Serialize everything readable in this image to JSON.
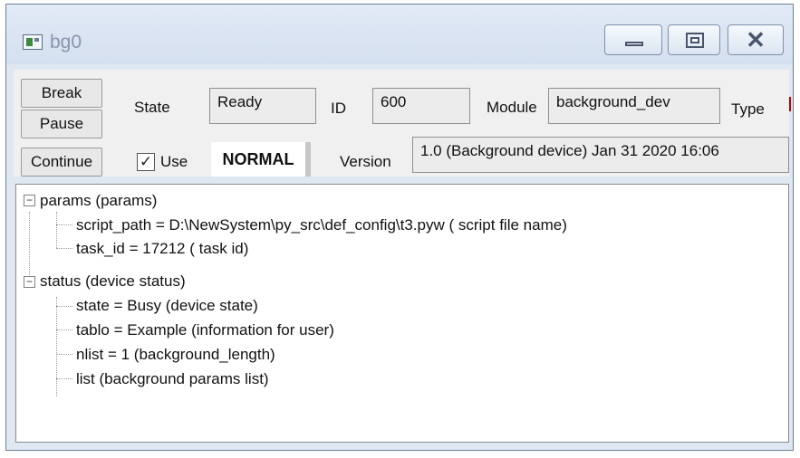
{
  "window": {
    "title": "bg0",
    "close_glyph": "✕"
  },
  "controls": {
    "break_label": "Break",
    "pause_label": "Pause",
    "continue_label": "Continue",
    "state_label": "State",
    "state_value": "Ready",
    "id_label": "ID",
    "id_value": "600",
    "module_label": "Module",
    "module_value": "background_dev",
    "type_label": "Type",
    "use_label": "Use",
    "use_checked": true,
    "use_check_glyph": "✓",
    "mode_value": "NORMAL",
    "version_label": "Version",
    "version_value": "1.0 (Background device) Jan 31 2020  16:06"
  },
  "tree": {
    "nodes": [
      {
        "label": "params (params)",
        "expanded": true,
        "expander": "−"
      },
      {
        "label": "script_path = D:\\NewSystem\\py_src\\def_config\\t3.pyw ( script file name)"
      },
      {
        "label": "task_id = 17212 ( task id)"
      },
      {
        "label": "status (device status)",
        "expanded": true,
        "expander": "−"
      },
      {
        "label": "state = Busy (device state)"
      },
      {
        "label": "tablo = Example (information for user)"
      },
      {
        "label": "nlist = 1 (background_length)"
      },
      {
        "label": "list (background params list)"
      }
    ]
  },
  "colors": {
    "titlebar": "#d4e0ef",
    "dialog": "#f0f0f0",
    "accent_mark": "#c00000"
  }
}
